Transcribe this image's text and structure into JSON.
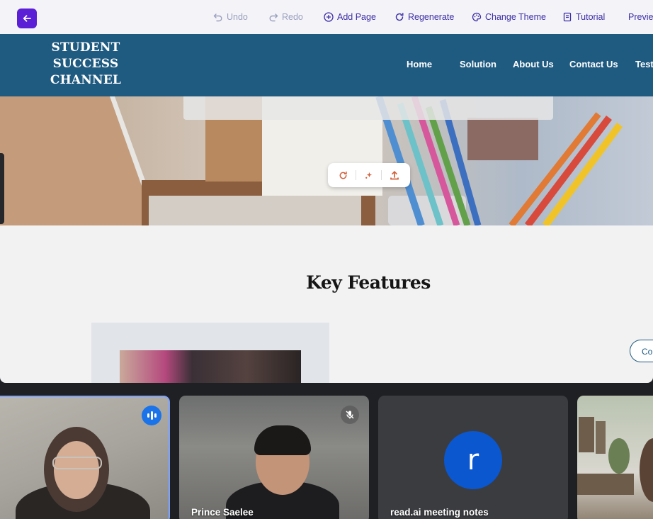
{
  "toolbar": {
    "undo": "Undo",
    "redo": "Redo",
    "add_page": "Add Page",
    "regenerate": "Regenerate",
    "change_theme": "Change Theme",
    "tutorial": "Tutorial",
    "preview": "Previe",
    "accent": "#5b1fd6"
  },
  "site": {
    "brand_line1": "STUDENT",
    "brand_line2": "SUCCESS",
    "brand_line3": "CHANNEL",
    "header_color": "#1f5a80",
    "nav": [
      "Home",
      "Solution",
      "About Us",
      "Contact Us",
      "Test"
    ],
    "features_title": "Key Features",
    "contact_pill": "Co"
  },
  "meeting": {
    "participants": [
      {
        "name": "",
        "state": "speaking"
      },
      {
        "name": "Prince Saelee",
        "state": "muted"
      },
      {
        "name": "read.ai meeting notes",
        "avatar_letter": "r"
      },
      {
        "name": ""
      }
    ]
  }
}
